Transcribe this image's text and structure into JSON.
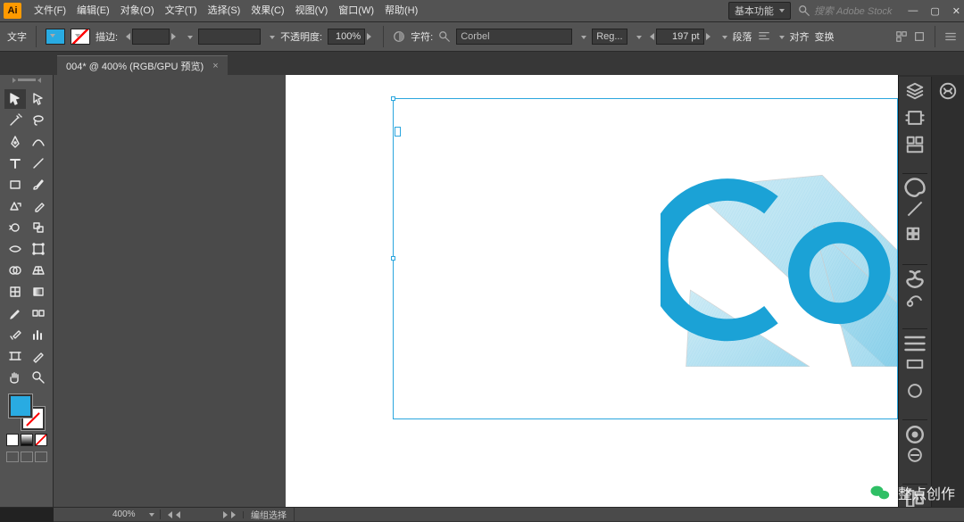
{
  "app": {
    "logo": "Ai",
    "workspace": "基本功能",
    "stock_placeholder": "搜索 Adobe Stock"
  },
  "menu": [
    "文件(F)",
    "编辑(E)",
    "对象(O)",
    "文字(T)",
    "选择(S)",
    "效果(C)",
    "视图(V)",
    "窗口(W)",
    "帮助(H)"
  ],
  "control": {
    "tool_mode": "文字",
    "stroke_label": "描边:",
    "stroke_val": "",
    "opacity_label": "不透明度:",
    "opacity_val": "100%",
    "char_label": "字符:",
    "font": "Corbel",
    "style": "Reg...",
    "size": "197 pt",
    "para": "段落",
    "align": "对齐",
    "transform": "变换"
  },
  "doc": {
    "tab": "004* @ 400% (RGB/GPU 预览)"
  },
  "status": {
    "zoom": "400%",
    "hint": "编组选择"
  },
  "watermark": "整点创作",
  "art_text": "Co"
}
